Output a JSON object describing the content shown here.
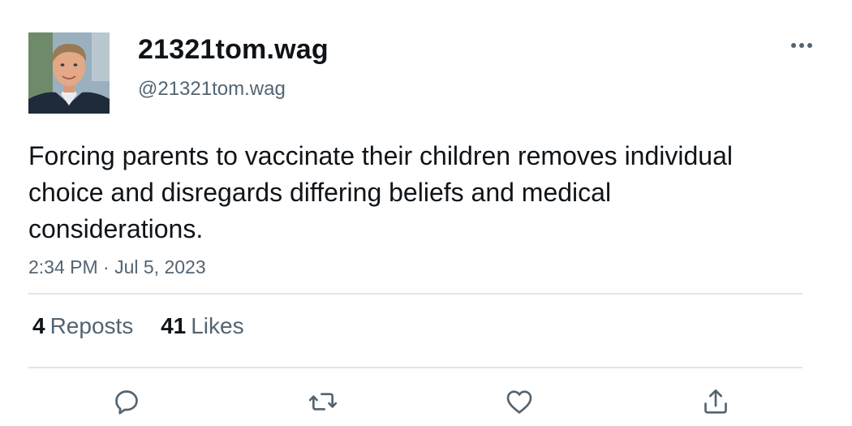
{
  "author": {
    "display_name": "21321tom.wag",
    "handle": "@21321tom.wag",
    "avatar": "profile-photo"
  },
  "tweet": {
    "text": "Forcing parents to vaccinate their children removes individual choice and disregards differing beliefs and medical considerations.",
    "timestamp": "2:34 PM · Jul 5, 2023"
  },
  "stats": {
    "reposts_count": "4",
    "reposts_label": "Reposts",
    "likes_count": "41",
    "likes_label": "Likes"
  },
  "actions": {
    "reply_icon": "reply-icon",
    "repost_icon": "repost-icon",
    "like_icon": "heart-icon",
    "share_icon": "share-icon",
    "more_icon": "more-icon"
  },
  "colors": {
    "text_primary": "#0f1419",
    "text_secondary": "#536471",
    "divider": "#e3e6e8"
  }
}
